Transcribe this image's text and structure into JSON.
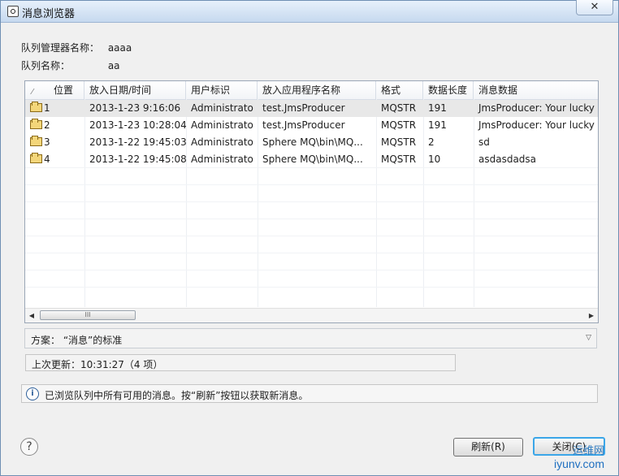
{
  "window": {
    "title": "消息浏览器",
    "close_label": "✕"
  },
  "info": [
    {
      "label": "队列管理器名称：",
      "value": "aaaa"
    },
    {
      "label": "队列名称：",
      "value": "aa"
    }
  ],
  "table": {
    "sort_icon": "⁄",
    "columns": [
      "位置",
      "放入日期/时间",
      "用户标识",
      "放入应用程序名称",
      "格式",
      "数据长度",
      "消息数据"
    ],
    "rows": [
      [
        "1",
        "2013-1-23 9:16:06",
        "Administrato",
        "test.JmsProducer",
        "MQSTR",
        "191",
        "JmsProducer: Your lucky"
      ],
      [
        "2",
        "2013-1-23 10:28:04",
        "Administrato",
        "test.JmsProducer",
        "MQSTR",
        "191",
        "JmsProducer: Your lucky"
      ],
      [
        "3",
        "2013-1-22 19:45:03",
        "Administrato",
        "Sphere MQ\\bin\\MQ...",
        "MQSTR",
        "2",
        "sd"
      ],
      [
        "4",
        "2013-1-22 19:45:08",
        "Administrato",
        "Sphere MQ\\bin\\MQ...",
        "MQSTR",
        "10",
        "asdasdadsa"
      ]
    ],
    "scroll_grip": "III"
  },
  "scheme": {
    "text": "方案：  “消息”的标准",
    "dropdown_icon": "▽"
  },
  "status": {
    "text": "上次更新：10:31:27（4 项）"
  },
  "message": {
    "icon": "i",
    "text": "已浏览队列中所有可用的消息。按“刷新”按钮以获取新消息。"
  },
  "help": {
    "icon": "?"
  },
  "buttons": {
    "refresh": "刷新(R)",
    "close": "关闭(C)"
  },
  "watermark": {
    "top": "运维网",
    "bottom": "iyunv.com"
  }
}
